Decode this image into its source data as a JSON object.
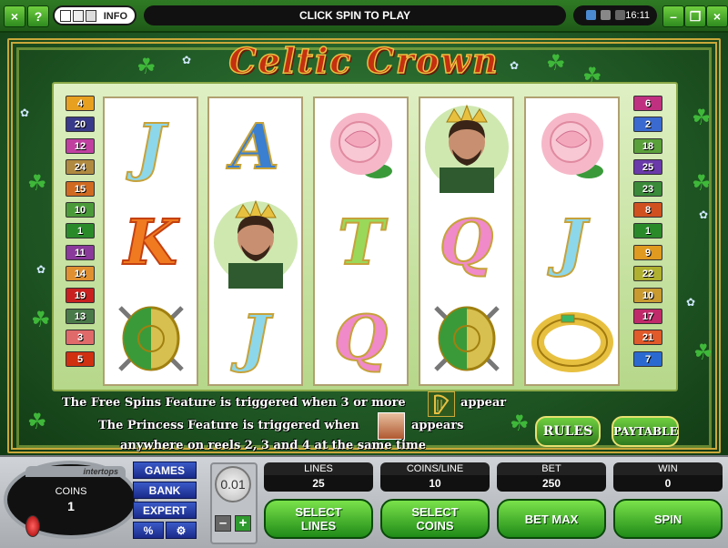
{
  "topbar": {
    "close": "×",
    "help": "?",
    "info": "INFO",
    "message": "CLICK SPIN TO PLAY",
    "time": "16:11",
    "minimize": "–",
    "restore": "❐",
    "close_window": "×"
  },
  "game": {
    "title": "Celtic Crown",
    "reels": [
      [
        "letter-J",
        "letter-K",
        "shield"
      ],
      [
        "letter-A",
        "king",
        "letter-J"
      ],
      [
        "rose",
        "letter-T",
        "letter-Q"
      ],
      [
        "king",
        "letter-Q",
        "shield"
      ],
      [
        "rose",
        "letter-J",
        "ring"
      ]
    ],
    "symbol_letters": {
      "letter-J": "J",
      "letter-A": "A",
      "letter-K": "K",
      "letter-T": "T",
      "letter-Q": "Q"
    },
    "left_lines": [
      {
        "n": "4",
        "color": "#e8a020"
      },
      {
        "n": "20",
        "color": "#3a3a8a"
      },
      {
        "n": "12",
        "color": "#c040a0"
      },
      {
        "n": "24",
        "color": "#b08a40"
      },
      {
        "n": "15",
        "color": "#d06a20"
      },
      {
        "n": "10",
        "color": "#4a9a3a"
      },
      {
        "n": "1",
        "color": "#2a8a2a"
      },
      {
        "n": "11",
        "color": "#8a3a9a"
      },
      {
        "n": "14",
        "color": "#e09030"
      },
      {
        "n": "19",
        "color": "#c82020"
      },
      {
        "n": "13",
        "color": "#4a7a4a"
      },
      {
        "n": "3",
        "color": "#e06a6a"
      },
      {
        "n": "5",
        "color": "#d03010"
      }
    ],
    "right_lines": [
      {
        "n": "6",
        "color": "#c03080"
      },
      {
        "n": "2",
        "color": "#3a6ad0"
      },
      {
        "n": "18",
        "color": "#5aa03a"
      },
      {
        "n": "25",
        "color": "#6a3aaa"
      },
      {
        "n": "23",
        "color": "#3a8a3a"
      },
      {
        "n": "8",
        "color": "#d05020"
      },
      {
        "n": "1",
        "color": "#2a8a2a"
      },
      {
        "n": "9",
        "color": "#e09a20"
      },
      {
        "n": "22",
        "color": "#b0b030"
      },
      {
        "n": "10",
        "color": "#c89a30"
      },
      {
        "n": "17",
        "color": "#c02a6a"
      },
      {
        "n": "21",
        "color": "#e05a2a"
      },
      {
        "n": "7",
        "color": "#2a6ad0"
      }
    ],
    "feature_free_spins_a": "The Free Spins Feature is triggered when 3 or more",
    "feature_free_spins_b": "appear",
    "feature_princess_a": "The Princess Feature is triggered when",
    "feature_princess_b": "appears",
    "feature_princess_c": "anywhere on reels 2, 3 and 4 at the same time",
    "rules": "RULES",
    "paytable": "PAYTABLE"
  },
  "bottom": {
    "brand": "intertops",
    "coins_label": "COINS",
    "coins_value": "1",
    "menu": [
      "GAMES",
      "BANK",
      "EXPERT"
    ],
    "percent": "%",
    "coin_value": "0.01",
    "minus": "–",
    "plus": "+",
    "lines_label": "LINES",
    "lines_value": "25",
    "coinsline_label": "COINS/LINE",
    "coinsline_value": "10",
    "bet_label": "BET",
    "bet_value": "250",
    "win_label": "WIN",
    "win_value": "0",
    "select_lines": "SELECT LINES",
    "select_coins": "SELECT COINS",
    "bet_max": "BET MAX",
    "spin": "SPIN"
  }
}
